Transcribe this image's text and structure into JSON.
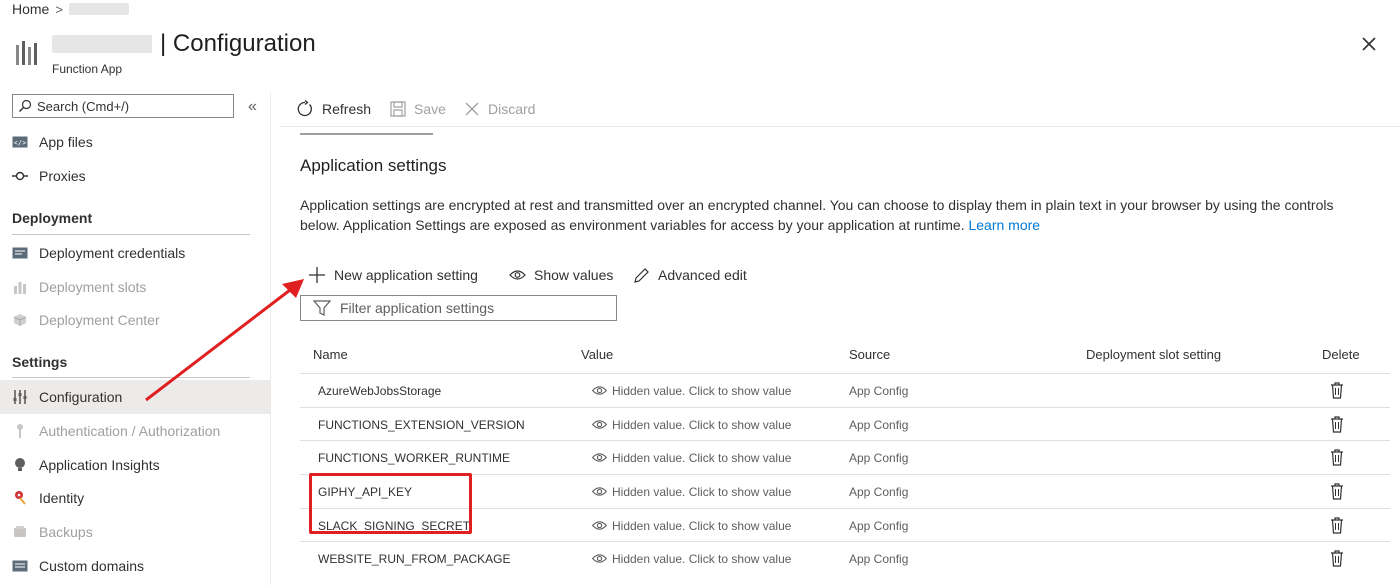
{
  "breadcrumb": {
    "home": "Home",
    "separator": ">"
  },
  "header": {
    "title": "| Configuration",
    "subtitle": "Function App"
  },
  "sidebar": {
    "search_placeholder": "Search (Cmd+/)",
    "collapse_icon": "«",
    "items_top": [
      {
        "label": "App files",
        "icon": "code-file-icon",
        "disabled": false
      },
      {
        "label": "Proxies",
        "icon": "proxy-icon",
        "disabled": false
      }
    ],
    "sections": [
      {
        "title": "Deployment",
        "items": [
          {
            "label": "Deployment credentials",
            "icon": "credentials-icon",
            "disabled": false
          },
          {
            "label": "Deployment slots",
            "icon": "slots-icon",
            "disabled": true
          },
          {
            "label": "Deployment Center",
            "icon": "cube-icon",
            "disabled": true
          }
        ]
      },
      {
        "title": "Settings",
        "items": [
          {
            "label": "Configuration",
            "icon": "sliders-icon",
            "disabled": false,
            "active": true
          },
          {
            "label": "Authentication / Authorization",
            "icon": "key-icon",
            "disabled": true
          },
          {
            "label": "Application Insights",
            "icon": "bulb-icon",
            "disabled": false
          },
          {
            "label": "Identity",
            "icon": "identity-icon",
            "disabled": false
          },
          {
            "label": "Backups",
            "icon": "backup-icon",
            "disabled": true
          },
          {
            "label": "Custom domains",
            "icon": "domain-icon",
            "disabled": false
          }
        ]
      }
    ]
  },
  "toolbar": {
    "refresh": "Refresh",
    "save": "Save",
    "discard": "Discard"
  },
  "main": {
    "heading": "Application settings",
    "description": "Application settings are encrypted at rest and transmitted over an encrypted channel. You can choose to display them in plain text in your browser by using the controls below. Application Settings are exposed as environment variables for access by your application at runtime.",
    "learn_more": "Learn more",
    "commands": {
      "new_setting": "New application setting",
      "show_values": "Show values",
      "advanced_edit": "Advanced edit"
    },
    "filter_placeholder": "Filter application settings"
  },
  "table": {
    "columns": {
      "name": "Name",
      "value": "Value",
      "source": "Source",
      "slot": "Deployment slot setting",
      "delete": "Delete"
    },
    "rows": [
      {
        "name": "AzureWebJobsStorage",
        "value": "Hidden value. Click to show value",
        "source": "App Config"
      },
      {
        "name": "FUNCTIONS_EXTENSION_VERSION",
        "value": "Hidden value. Click to show value",
        "source": "App Config"
      },
      {
        "name": "FUNCTIONS_WORKER_RUNTIME",
        "value": "Hidden value. Click to show value",
        "source": "App Config"
      },
      {
        "name": "GIPHY_API_KEY",
        "value": "Hidden value. Click to show value",
        "source": "App Config"
      },
      {
        "name": "SLACK_SIGNING_SECRET",
        "value": "Hidden value. Click to show value",
        "source": "App Config"
      },
      {
        "name": "WEBSITE_RUN_FROM_PACKAGE",
        "value": "Hidden value. Click to show value",
        "source": "App Config"
      }
    ]
  },
  "colors": {
    "accent": "#0078d4",
    "annotation": "#e02020",
    "active_bg": "#edebe9",
    "disabled_text": "#a19f9d"
  }
}
